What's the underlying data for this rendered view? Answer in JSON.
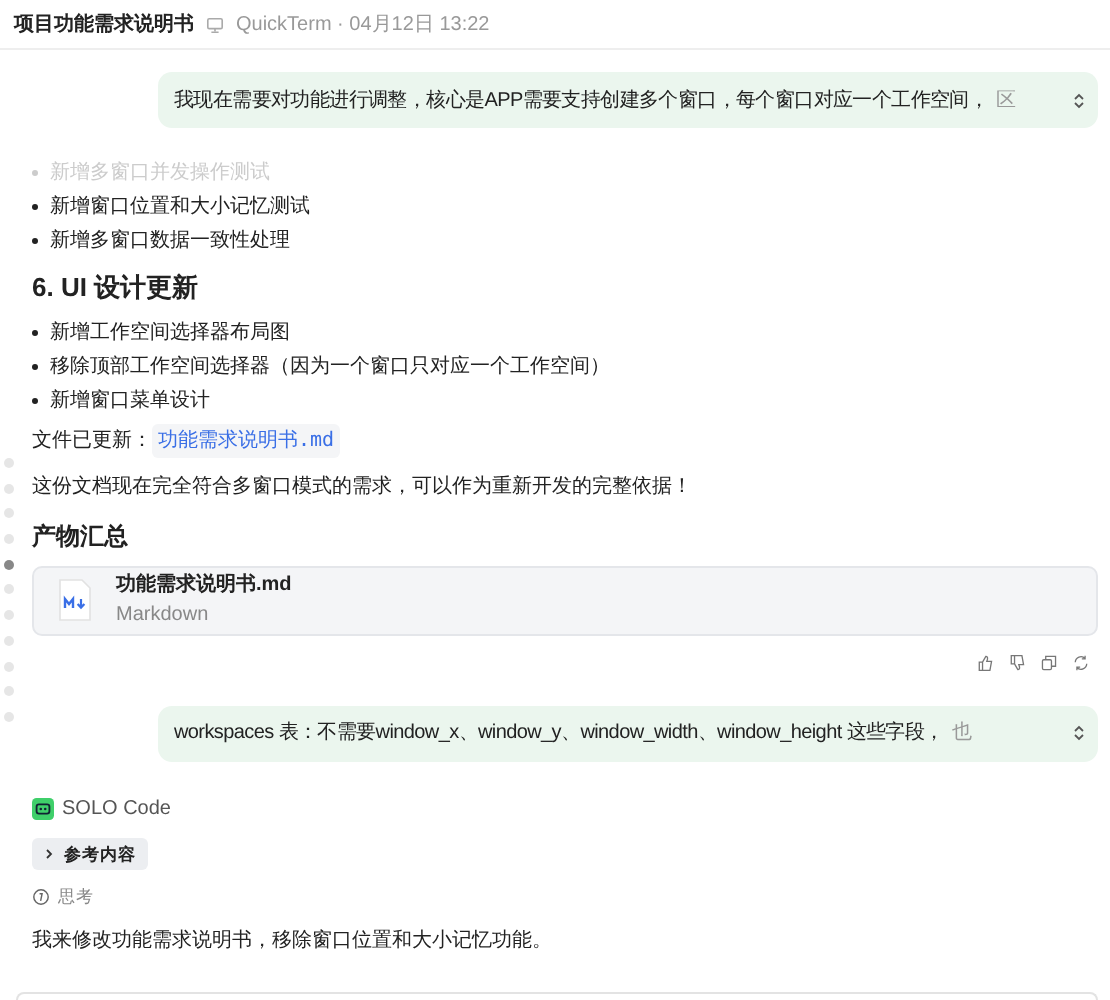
{
  "header": {
    "title": "项目功能需求说明书",
    "source": "QuickTerm · 04月12日 13:22"
  },
  "user_message_1": {
    "text": "我现在需要对功能进行调整，核心是APP需要支持创建多个窗口，每个窗口对应一个工作空间，",
    "fade_tail": "区"
  },
  "reply": {
    "list_1": [
      {
        "text": "新增多窗口并发操作测试",
        "faded": true
      },
      {
        "text": "新增窗口位置和大小记忆测试",
        "faded": false
      },
      {
        "text": "新增多窗口数据一致性处理",
        "faded": false
      }
    ],
    "heading": "6. UI 设计更新",
    "list_2": [
      {
        "text": "新增工作空间选择器布局图",
        "faded": false
      },
      {
        "text": "移除顶部工作空间选择器（因为一个窗口只对应一个工作空间）",
        "faded": false
      },
      {
        "text": "新增窗口菜单设计",
        "faded": false
      }
    ],
    "file_updated": {
      "label": "文件已更新：",
      "file": "功能需求说明书.md"
    },
    "paragraph": "这份文档现在完全符合多窗口模式的需求，可以作为重新开发的完整依据！",
    "artifacts": {
      "title": "产物汇总",
      "file": {
        "name": "功能需求说明书.md",
        "type": "Markdown"
      }
    }
  },
  "user_message_2": {
    "text": "workspaces 表：不需要window_x、window_y、window_width、window_height 这些字段，",
    "fade_tail": "也"
  },
  "agent": {
    "name": "SOLO Code",
    "reference": "参考内容",
    "thinking": "思考",
    "text": "我来修改功能需求说明书，移除窗口位置和大小记忆功能。"
  },
  "timeline": [
    {
      "selected": false
    },
    {
      "selected": false
    },
    {
      "selected": false
    },
    {
      "selected": false
    },
    {
      "selected": true
    },
    {
      "selected": false
    },
    {
      "selected": false
    },
    {
      "selected": false
    },
    {
      "selected": false
    },
    {
      "selected": false
    },
    {
      "selected": false
    }
  ]
}
